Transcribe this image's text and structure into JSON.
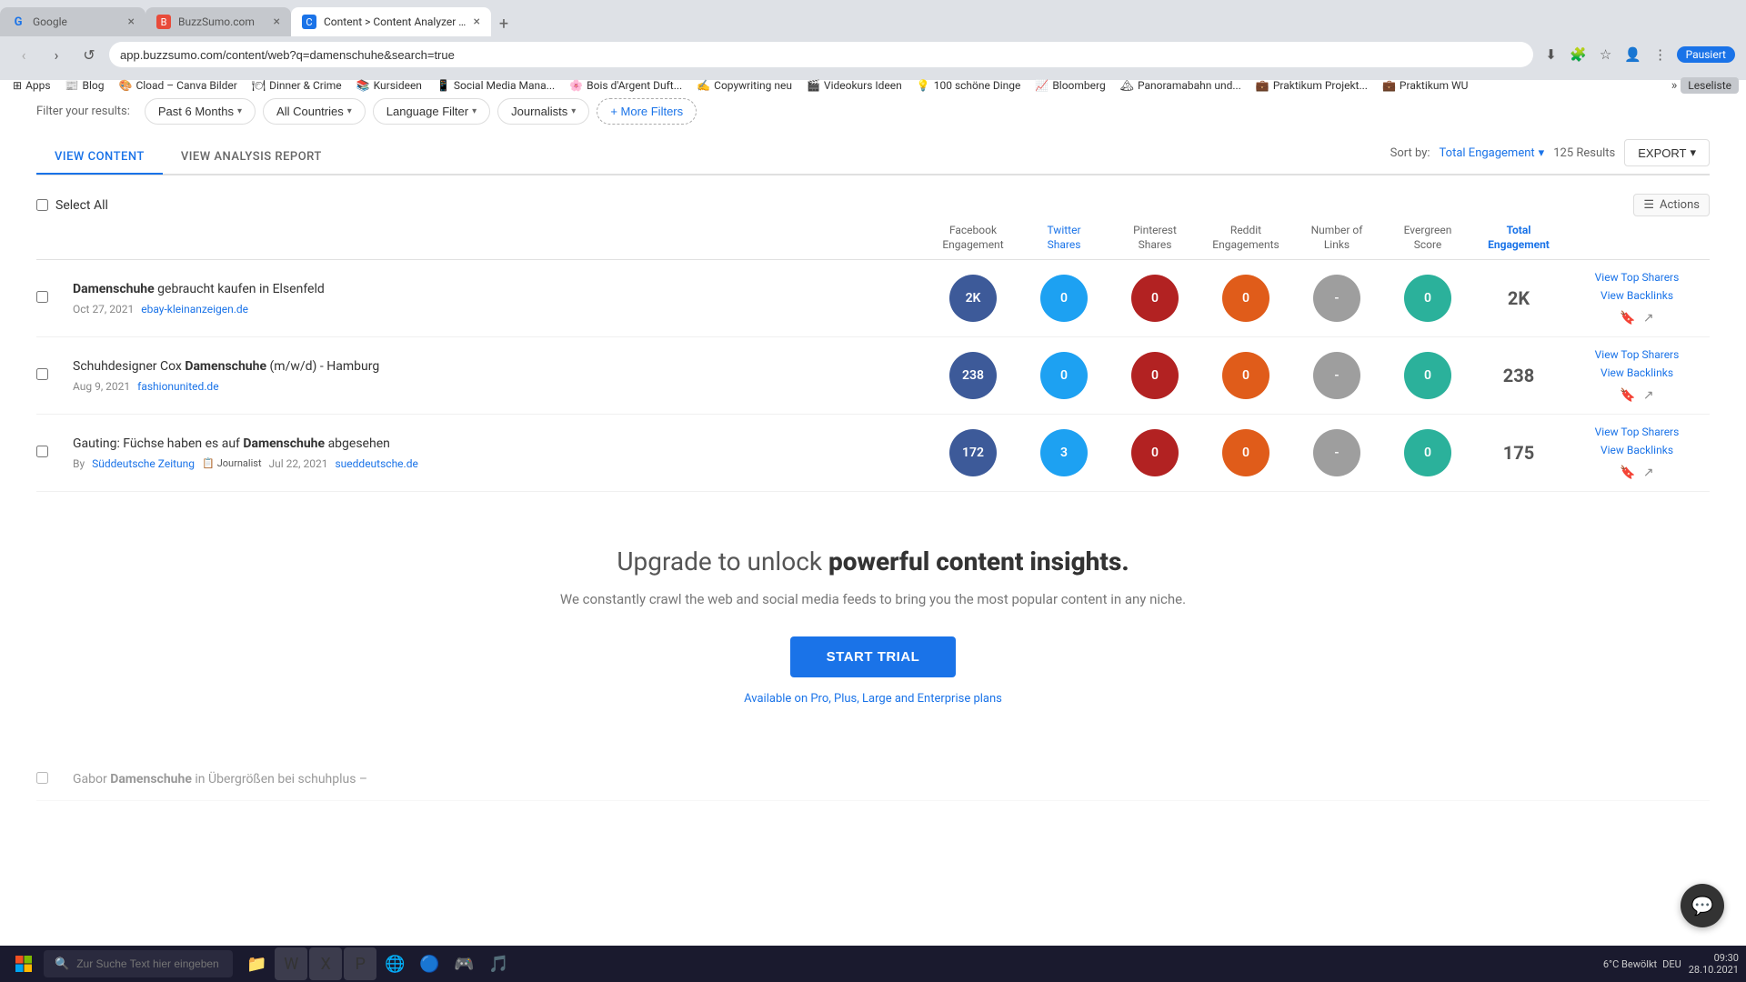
{
  "browser": {
    "tabs": [
      {
        "id": "google",
        "title": "Google",
        "favicon": "G",
        "favicon_bg": "#fff",
        "active": false
      },
      {
        "id": "buzzsumo",
        "title": "BuzzSumo.com",
        "favicon": "B",
        "favicon_bg": "#e84b3a",
        "active": false
      },
      {
        "id": "content",
        "title": "Content > Content Analyzer - B...",
        "favicon": "C",
        "favicon_bg": "#1a73e8",
        "active": true
      }
    ],
    "address": "app.buzzsumo.com/content/web?q=damenschuhe&search=true",
    "nav": {
      "back": "‹",
      "forward": "›",
      "refresh": "↺",
      "home": "⌂"
    },
    "profile": "Pausiert",
    "bookmarks": [
      "Apps",
      "Blog",
      "Cload – Canva Bilder",
      "Dinner & Crime",
      "Kursideen",
      "Social Media Mana...",
      "Bois d'Argent Duft...",
      "Copywriting neu",
      "Videokurs Ideen",
      "100 schöne Dinge",
      "Bloomberg",
      "Panoramabahn und...",
      "Praktikum Projekt...",
      "Praktikum WU"
    ],
    "reading_mode": "Leseliste"
  },
  "filters": {
    "label": "Filter your results:",
    "items": [
      {
        "id": "date",
        "label": "Past 6 Months",
        "arrow": "▾"
      },
      {
        "id": "country",
        "label": "All Countries",
        "arrow": "▾"
      },
      {
        "id": "language",
        "label": "Language Filter",
        "arrow": "▾"
      },
      {
        "id": "journalists",
        "label": "Journalists",
        "arrow": "▾"
      }
    ],
    "more_filters": "+ More Filters"
  },
  "view_tabs": {
    "items": [
      {
        "id": "view-content",
        "label": "VIEW CONTENT",
        "active": true
      },
      {
        "id": "view-analysis",
        "label": "VIEW ANALYSIS REPORT",
        "active": false
      }
    ]
  },
  "sort_bar": {
    "sort_label": "Sort by:",
    "sort_value": "Total Engagement",
    "results": "125 Results",
    "export": "EXPORT"
  },
  "table": {
    "headers": [
      {
        "id": "check",
        "label": ""
      },
      {
        "id": "title",
        "label": ""
      },
      {
        "id": "facebook",
        "label": "Facebook\nEngagement"
      },
      {
        "id": "twitter",
        "label": "Twitter\nShares"
      },
      {
        "id": "pinterest",
        "label": "Pinterest\nShares"
      },
      {
        "id": "reddit",
        "label": "Reddit\nEngagements"
      },
      {
        "id": "links",
        "label": "Number of\nLinks"
      },
      {
        "id": "evergreen",
        "label": "Evergreen\nScore"
      },
      {
        "id": "total",
        "label": "Total\nEngagement",
        "active": true
      }
    ],
    "select_all": "Select All",
    "actions_label": "Actions",
    "rows": [
      {
        "id": "row1",
        "title_prefix": "Damenschuhe",
        "title_suffix": " gebraucht kaufen in Elsenfeld",
        "date": "Oct 27, 2021",
        "url": "ebay-kleinanzeigen.de",
        "by": null,
        "journalist": null,
        "facebook": "2K",
        "facebook_color": "blue-dark",
        "twitter": "0",
        "twitter_color": "blue-light",
        "pinterest": "0",
        "pinterest_color": "red-dark",
        "reddit": "0",
        "reddit_color": "red-orange",
        "links": "-",
        "links_color": "gray",
        "evergreen": "0",
        "evergreen_color": "teal",
        "total": "2K",
        "view_top_sharers": "View Top Sharers",
        "view_backlinks": "View Backlinks"
      },
      {
        "id": "row2",
        "title_prefix": "Schuhdesigner Cox ",
        "bold_word": "Damenschuhe",
        "title_suffix": " (m/w/d) - Hamburg",
        "date": "Aug 9, 2021",
        "url": "fashionunited.de",
        "by": null,
        "journalist": null,
        "facebook": "238",
        "facebook_color": "blue-dark",
        "twitter": "0",
        "twitter_color": "blue-light",
        "pinterest": "0",
        "pinterest_color": "red-dark",
        "reddit": "0",
        "reddit_color": "red-orange",
        "links": "-",
        "links_color": "gray",
        "evergreen": "0",
        "evergreen_color": "teal",
        "total": "238",
        "view_top_sharers": "View Top Sharers",
        "view_backlinks": "View Backlinks"
      },
      {
        "id": "row3",
        "title_prefix": "Gauting: Füchse haben es auf ",
        "bold_word": "Damenschuhe",
        "title_suffix": " abgesehen",
        "date": "Jul 22, 2021",
        "url": "sueddeutsche.de",
        "by": "By",
        "source": "Süddeutsche Zeitung",
        "journalist_label": "Journalist",
        "facebook": "172",
        "facebook_color": "blue-dark",
        "twitter": "3",
        "twitter_color": "blue-light",
        "pinterest": "0",
        "pinterest_color": "red-dark",
        "reddit": "0",
        "reddit_color": "red-orange",
        "links": "-",
        "links_color": "gray",
        "evergreen": "0",
        "evergreen_color": "teal",
        "total": "175",
        "view_top_sharers": "View Top Sharers",
        "view_backlinks": "View Backlinks"
      }
    ]
  },
  "upgrade": {
    "title_normal": "Upgrade to unlock ",
    "title_bold": "powerful content insights.",
    "subtitle": "We constantly crawl the web and social media feeds to bring you the most popular content in any niche.",
    "cta": "START TRIAL",
    "plans_link": "Available on Pro, Plus, Large and Enterprise plans"
  },
  "bottom_row": {
    "title_prefix": "Gabor ",
    "bold_word": "Damenschuhe",
    "title_suffix": " in Übergrößen bei schuhplus –"
  },
  "taskbar": {
    "search_placeholder": "Zur Suche Text hier eingeben",
    "apps": [
      "⊞",
      "📁",
      "📄",
      "📊",
      "📋",
      "🌐",
      "🔵",
      "🐉",
      "🎵",
      "🎮"
    ],
    "time": "09:30",
    "date": "28.10.2021",
    "weather": "6°C Bewölkt",
    "lang": "DEU"
  }
}
